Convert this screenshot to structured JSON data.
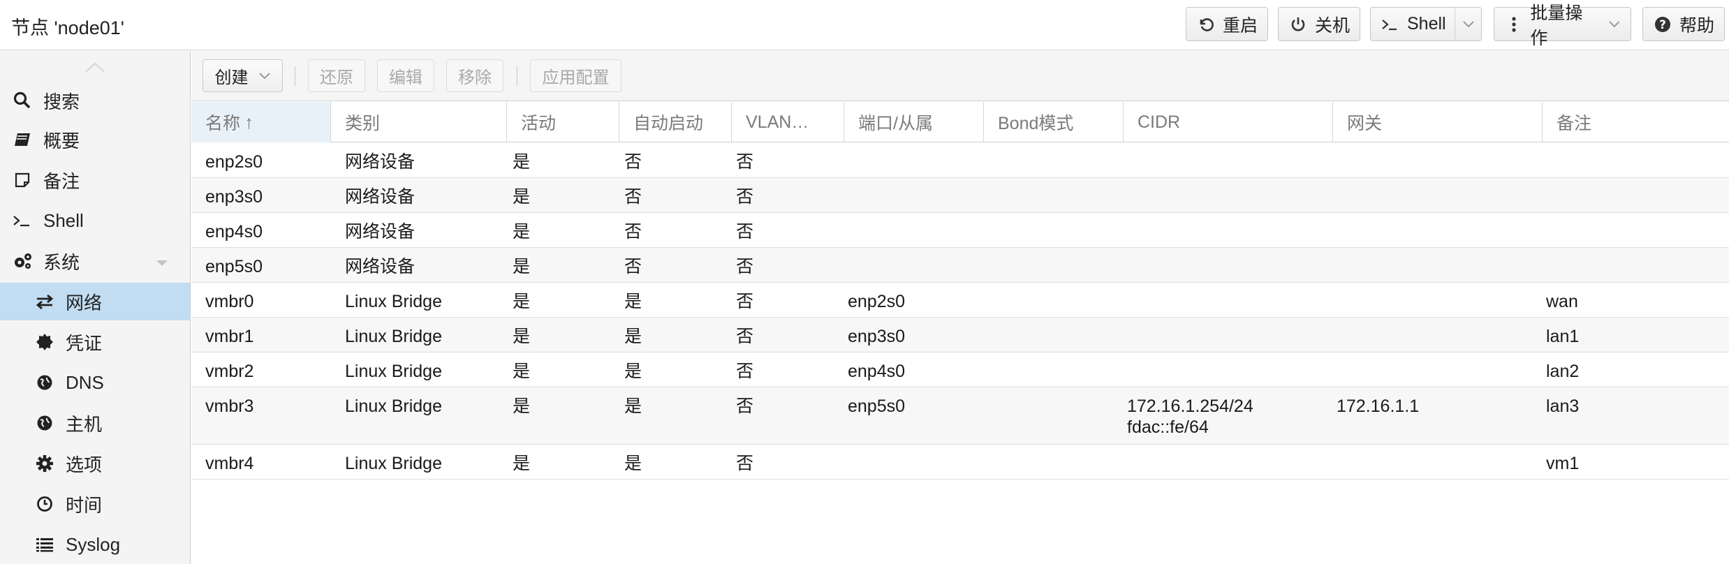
{
  "header": {
    "title": "节点 'node01'",
    "buttons": {
      "reboot": "重启",
      "shutdown": "关机",
      "shell": "Shell",
      "bulk": "批量操作",
      "help": "帮助"
    }
  },
  "sidebar": {
    "items": [
      {
        "label": "搜索",
        "icon": "search-icon"
      },
      {
        "label": "概要",
        "icon": "book-icon"
      },
      {
        "label": "备注",
        "icon": "note-icon"
      },
      {
        "label": "Shell",
        "icon": "terminal-icon"
      },
      {
        "label": "系统",
        "icon": "gears-icon"
      },
      {
        "label": "网络",
        "icon": "exchange-icon"
      },
      {
        "label": "凭证",
        "icon": "certificate-icon"
      },
      {
        "label": "DNS",
        "icon": "globe-icon"
      },
      {
        "label": "主机",
        "icon": "globe-icon"
      },
      {
        "label": "选项",
        "icon": "gear-icon"
      },
      {
        "label": "时间",
        "icon": "clock-icon"
      },
      {
        "label": "Syslog",
        "icon": "list-icon"
      }
    ]
  },
  "toolbar": {
    "create": "创建",
    "revert": "还原",
    "edit": "编辑",
    "remove": "移除",
    "apply": "应用配置"
  },
  "grid": {
    "columns": [
      "名称",
      "类别",
      "活动",
      "自动启动",
      "VLAN…",
      "端口/从属",
      "Bond模式",
      "CIDR",
      "网关",
      "备注"
    ],
    "sort_indicator": "↑",
    "rows": [
      {
        "name": "enp2s0",
        "type": "网络设备",
        "active": "是",
        "autostart": "否",
        "vlan": "否",
        "ports": "",
        "bond": "",
        "cidr": "",
        "cidr2": "",
        "gateway": "",
        "comment": ""
      },
      {
        "name": "enp3s0",
        "type": "网络设备",
        "active": "是",
        "autostart": "否",
        "vlan": "否",
        "ports": "",
        "bond": "",
        "cidr": "",
        "cidr2": "",
        "gateway": "",
        "comment": ""
      },
      {
        "name": "enp4s0",
        "type": "网络设备",
        "active": "是",
        "autostart": "否",
        "vlan": "否",
        "ports": "",
        "bond": "",
        "cidr": "",
        "cidr2": "",
        "gateway": "",
        "comment": ""
      },
      {
        "name": "enp5s0",
        "type": "网络设备",
        "active": "是",
        "autostart": "否",
        "vlan": "否",
        "ports": "",
        "bond": "",
        "cidr": "",
        "cidr2": "",
        "gateway": "",
        "comment": ""
      },
      {
        "name": "vmbr0",
        "type": "Linux Bridge",
        "active": "是",
        "autostart": "是",
        "vlan": "否",
        "ports": "enp2s0",
        "bond": "",
        "cidr": "",
        "cidr2": "",
        "gateway": "",
        "comment": "wan"
      },
      {
        "name": "vmbr1",
        "type": "Linux Bridge",
        "active": "是",
        "autostart": "是",
        "vlan": "否",
        "ports": "enp3s0",
        "bond": "",
        "cidr": "",
        "cidr2": "",
        "gateway": "",
        "comment": "lan1"
      },
      {
        "name": "vmbr2",
        "type": "Linux Bridge",
        "active": "是",
        "autostart": "是",
        "vlan": "否",
        "ports": "enp4s0",
        "bond": "",
        "cidr": "",
        "cidr2": "",
        "gateway": "",
        "comment": "lan2"
      },
      {
        "name": "vmbr3",
        "type": "Linux Bridge",
        "active": "是",
        "autostart": "是",
        "vlan": "否",
        "ports": "enp5s0",
        "bond": "",
        "cidr": "172.16.1.254/24",
        "cidr2": "fdac::fe/64",
        "gateway": "172.16.1.1",
        "comment": "lan3"
      },
      {
        "name": "vmbr4",
        "type": "Linux Bridge",
        "active": "是",
        "autostart": "是",
        "vlan": "否",
        "ports": "",
        "bond": "",
        "cidr": "",
        "cidr2": "",
        "gateway": "",
        "comment": "vm1"
      }
    ]
  }
}
